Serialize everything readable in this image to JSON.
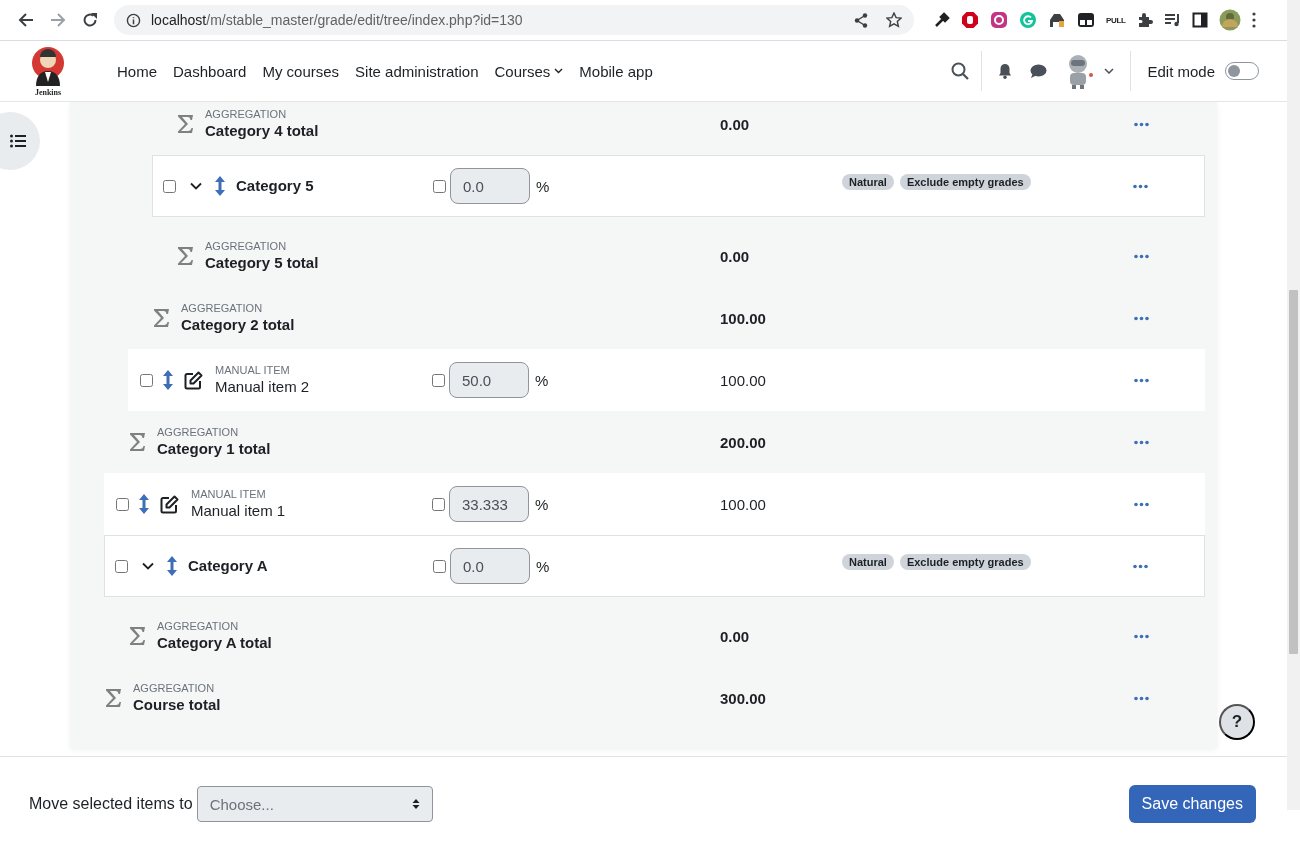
{
  "browser": {
    "url_host": "localhost",
    "url_path": "/m/stable_master/grade/edit/tree/index.php?id=130",
    "extension_label": "PULL"
  },
  "nav": {
    "logo_caption": "Jenkins",
    "links": [
      {
        "label": "Home",
        "dropdown": false
      },
      {
        "label": "Dashboard",
        "dropdown": false
      },
      {
        "label": "My courses",
        "dropdown": false
      },
      {
        "label": "Site administration",
        "dropdown": false
      },
      {
        "label": "Courses",
        "dropdown": true
      },
      {
        "label": "Mobile app",
        "dropdown": false
      }
    ],
    "edit_mode": {
      "label": "Edit mode",
      "on": false
    }
  },
  "tree": [
    {
      "children": [
        {
          "children": [
            {
              "children": [
                {
                  "kind": "aggregation",
                  "type_label": "AGGREGATION",
                  "name": "Category 4 total",
                  "value": "0.00"
                }
              ]
            },
            {
              "kind": "category",
              "checked": false,
              "expanded": true,
              "name": "Category 5",
              "weight_override": false,
              "weight": "0.0",
              "unit": "%",
              "badges": [
                "Natural",
                "Exclude empty grades"
              ],
              "children": [
                {
                  "kind": "aggregation",
                  "type_label": "AGGREGATION",
                  "name": "Category 5 total",
                  "value": "0.00"
                }
              ]
            },
            {
              "kind": "aggregation",
              "type_label": "AGGREGATION",
              "name": "Category 2 total",
              "value": "100.00"
            }
          ]
        },
        {
          "kind": "item",
          "checked": false,
          "type_label": "MANUAL ITEM",
          "name": "Manual item 2",
          "weight_override": false,
          "weight": "50.0",
          "unit": "%",
          "value": "100.00"
        },
        {
          "kind": "aggregation",
          "type_label": "AGGREGATION",
          "name": "Category 1 total",
          "value": "200.00"
        }
      ]
    },
    {
      "kind": "item",
      "checked": false,
      "type_label": "MANUAL ITEM",
      "name": "Manual item 1",
      "weight_override": false,
      "weight": "33.333",
      "unit": "%",
      "value": "100.00"
    },
    {
      "kind": "category",
      "checked": false,
      "expanded": true,
      "name": "Category A",
      "weight_override": false,
      "weight": "0.0",
      "unit": "%",
      "badges": [
        "Natural",
        "Exclude empty grades"
      ],
      "children": [
        {
          "kind": "aggregation",
          "type_label": "AGGREGATION",
          "name": "Category A total",
          "value": "0.00"
        }
      ]
    },
    {
      "kind": "aggregation",
      "type_label": "AGGREGATION",
      "name": "Course total",
      "value": "300.00"
    }
  ],
  "help": "?",
  "footer": {
    "move_label": "Move selected items to",
    "select_placeholder": "Choose...",
    "save": "Save changes"
  }
}
